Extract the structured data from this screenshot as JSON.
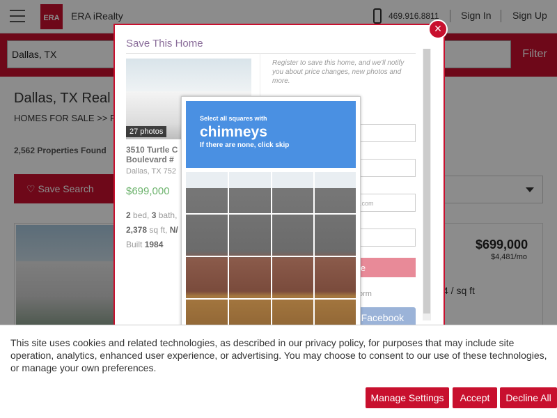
{
  "header": {
    "brand": "ERA iRealty",
    "logo_text": "ERA",
    "phone": "469.916.8811",
    "sign_in": "Sign In",
    "sign_up": "Sign Up"
  },
  "search": {
    "value": "Dallas, TX",
    "filter_label": "Filter"
  },
  "page": {
    "title": "Dallas, TX Real",
    "breadcrumb": "HOMES FOR SALE  >>  F",
    "count": "2,562 Properties Found",
    "save_search": "Save Search"
  },
  "listing": {
    "price": "$699,000",
    "monthly": "$4,481/mo",
    "per_sqft": "4 / sq ft"
  },
  "modal": {
    "title": "Save This Home",
    "photos": "27 photos",
    "address": "3510 Turtle C Boulevard #",
    "city": "Dallas, TX 752",
    "price": "$699,000",
    "beds": "2",
    "baths": "3",
    "sqft": "2,378",
    "built": "1984",
    "register_text": "Register to save this home, and we'll notify you about price changes, new photos and more.",
    "email_placeholder": "ail.com",
    "signup_label": "me",
    "or_text": "orm",
    "facebook_label": "n Facebook",
    "close_label": "×"
  },
  "captcha": {
    "instruction": "Select all squares with",
    "keyword": "chimneys",
    "hint": "If there are none, click skip"
  },
  "cookie": {
    "text": "This site uses cookies and related technologies, as described in our privacy policy, for purposes that may include site operation, analytics, enhanced user experience, or advertising. You may choose to consent to our use of these technologies, or manage your own preferences.",
    "manage": "Manage Settings",
    "accept": "Accept",
    "decline": "Decline All"
  },
  "colors": {
    "brand": "#c8102e",
    "captcha_blue": "#4a90e2"
  },
  "icons": [
    "hamburger-menu-icon",
    "phone-icon",
    "heart-icon",
    "chevron-down-icon",
    "close-icon"
  ]
}
